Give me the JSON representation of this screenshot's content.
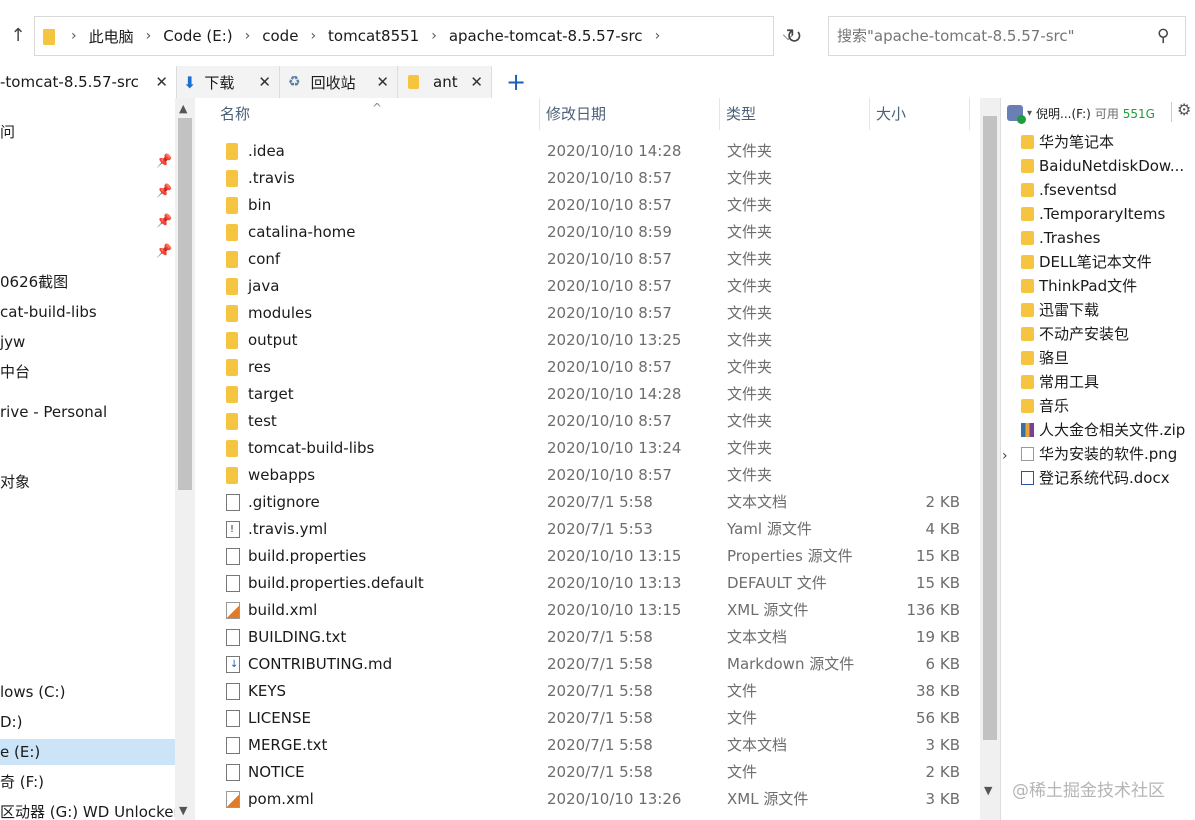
{
  "address": {
    "crumbs": [
      "此电脑",
      "Code (E:)",
      "code",
      "tomcat8551",
      "apache-tomcat-8.5.57-src"
    ],
    "search_placeholder": "搜索\"apache-tomcat-8.5.57-src\""
  },
  "tabs": [
    {
      "label": "-tomcat-8.5.57-src",
      "icon": "folder-icon"
    },
    {
      "label": "下载",
      "icon": "download-icon"
    },
    {
      "label": "回收站",
      "icon": "recycle-bin-icon"
    },
    {
      "label": "ant",
      "icon": "folder-icon"
    }
  ],
  "nav": {
    "items": [
      {
        "label": "问",
        "y": 0
      },
      {
        "label": "0626截图",
        "y": 0
      },
      {
        "label": "cat-build-libs",
        "y": 0
      },
      {
        "label": "jyw",
        "y": 0
      },
      {
        "label": "中台",
        "y": 0
      },
      {
        "label": "rive - Personal",
        "y": 0
      },
      {
        "label": "对象",
        "y": 0
      },
      {
        "label": "lows (C:)",
        "y": 0
      },
      {
        "label": "D:)",
        "y": 0
      },
      {
        "label": "e (E:)",
        "y": 0
      },
      {
        "label": "奇 (F:)",
        "y": 0
      },
      {
        "label": "区动器 (G:) WD Unlocker",
        "y": 0
      }
    ]
  },
  "columns": {
    "name": "名称",
    "date": "修改日期",
    "type": "类型",
    "size": "大小"
  },
  "files": [
    {
      "name": ".idea",
      "date": "2020/10/10 14:28",
      "type": "文件夹",
      "size": "",
      "icon": "folder"
    },
    {
      "name": ".travis",
      "date": "2020/10/10 8:57",
      "type": "文件夹",
      "size": "",
      "icon": "folder"
    },
    {
      "name": "bin",
      "date": "2020/10/10 8:57",
      "type": "文件夹",
      "size": "",
      "icon": "folder"
    },
    {
      "name": "catalina-home",
      "date": "2020/10/10 8:59",
      "type": "文件夹",
      "size": "",
      "icon": "folder"
    },
    {
      "name": "conf",
      "date": "2020/10/10 8:57",
      "type": "文件夹",
      "size": "",
      "icon": "folder"
    },
    {
      "name": "java",
      "date": "2020/10/10 8:57",
      "type": "文件夹",
      "size": "",
      "icon": "folder"
    },
    {
      "name": "modules",
      "date": "2020/10/10 8:57",
      "type": "文件夹",
      "size": "",
      "icon": "folder"
    },
    {
      "name": "output",
      "date": "2020/10/10 13:25",
      "type": "文件夹",
      "size": "",
      "icon": "folder"
    },
    {
      "name": "res",
      "date": "2020/10/10 8:57",
      "type": "文件夹",
      "size": "",
      "icon": "folder"
    },
    {
      "name": "target",
      "date": "2020/10/10 14:28",
      "type": "文件夹",
      "size": "",
      "icon": "folder"
    },
    {
      "name": "test",
      "date": "2020/10/10 8:57",
      "type": "文件夹",
      "size": "",
      "icon": "folder"
    },
    {
      "name": "tomcat-build-libs",
      "date": "2020/10/10 13:24",
      "type": "文件夹",
      "size": "",
      "icon": "folder"
    },
    {
      "name": "webapps",
      "date": "2020/10/10 8:57",
      "type": "文件夹",
      "size": "",
      "icon": "folder"
    },
    {
      "name": ".gitignore",
      "date": "2020/7/1 5:58",
      "type": "文本文档",
      "size": "2 KB",
      "icon": "doc"
    },
    {
      "name": ".travis.yml",
      "date": "2020/7/1 5:53",
      "type": "Yaml 源文件",
      "size": "4 KB",
      "icon": "yaml"
    },
    {
      "name": "build.properties",
      "date": "2020/10/10 13:15",
      "type": "Properties 源文件",
      "size": "15 KB",
      "icon": "doc"
    },
    {
      "name": "build.properties.default",
      "date": "2020/10/10 13:13",
      "type": "DEFAULT 文件",
      "size": "15 KB",
      "icon": "doc"
    },
    {
      "name": "build.xml",
      "date": "2020/10/10 13:15",
      "type": "XML 源文件",
      "size": "136 KB",
      "icon": "xml"
    },
    {
      "name": "BUILDING.txt",
      "date": "2020/7/1 5:58",
      "type": "文本文档",
      "size": "19 KB",
      "icon": "doc"
    },
    {
      "name": "CONTRIBUTING.md",
      "date": "2020/7/1 5:58",
      "type": "Markdown 源文件",
      "size": "6 KB",
      "icon": "md"
    },
    {
      "name": "KEYS",
      "date": "2020/7/1 5:58",
      "type": "文件",
      "size": "38 KB",
      "icon": "doc"
    },
    {
      "name": "LICENSE",
      "date": "2020/7/1 5:58",
      "type": "文件",
      "size": "56 KB",
      "icon": "doc"
    },
    {
      "name": "MERGE.txt",
      "date": "2020/7/1 5:58",
      "type": "文本文档",
      "size": "3 KB",
      "icon": "doc"
    },
    {
      "name": "NOTICE",
      "date": "2020/7/1 5:58",
      "type": "文件",
      "size": "2 KB",
      "icon": "doc"
    },
    {
      "name": "pom.xml",
      "date": "2020/10/10 13:26",
      "type": "XML 源文件",
      "size": "3 KB",
      "icon": "xml"
    }
  ],
  "right_pane": {
    "drive_label": "倪明...(F:)",
    "free_label": "可用",
    "free_value": "551G",
    "items": [
      {
        "label": "华为笔记本",
        "icon": "folder"
      },
      {
        "label": "BaiduNetdiskDow...",
        "icon": "folder"
      },
      {
        "label": ".fseventsd",
        "icon": "folder"
      },
      {
        "label": ".TemporaryItems",
        "icon": "folder"
      },
      {
        "label": ".Trashes",
        "icon": "folder"
      },
      {
        "label": "DELL笔记本文件",
        "icon": "folder"
      },
      {
        "label": "ThinkPad文件",
        "icon": "folder"
      },
      {
        "label": "迅雷下载",
        "icon": "folder"
      },
      {
        "label": "不动产安装包",
        "icon": "folder"
      },
      {
        "label": "骆旦",
        "icon": "folder"
      },
      {
        "label": "常用工具",
        "icon": "folder"
      },
      {
        "label": "音乐",
        "icon": "folder"
      },
      {
        "label": "人大金仓相关文件.zip",
        "icon": "zip"
      },
      {
        "label": "华为安装的软件.png",
        "icon": "png"
      },
      {
        "label": "登记系统代码.docx",
        "icon": "docx"
      }
    ]
  },
  "watermark": "@稀土掘金技术社区"
}
